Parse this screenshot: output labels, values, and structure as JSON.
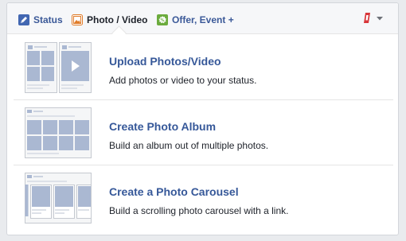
{
  "tabs": [
    {
      "label": "Status",
      "icon": "pencil-icon"
    },
    {
      "label": "Photo / Video",
      "icon": "photo-icon"
    },
    {
      "label": "Offer, Event +",
      "icon": "offer-icon"
    }
  ],
  "colors": {
    "link": "#365899",
    "status_icon": "#4267b2",
    "photo_icon": "#e07c2a",
    "offer_icon": "#6bab3d",
    "privacy_icon": "#d8363a",
    "thumb_fill": "#aab8d2"
  },
  "options": [
    {
      "title": "Upload Photos/Video",
      "description": "Add photos or video to your status.",
      "icon": "upload-photos-thumbnail"
    },
    {
      "title": "Create Photo Album",
      "description": "Build an album out of multiple photos.",
      "icon": "photo-album-thumbnail"
    },
    {
      "title": "Create a Photo Carousel",
      "description": "Build a scrolling photo carousel with a link.",
      "icon": "photo-carousel-thumbnail"
    }
  ]
}
